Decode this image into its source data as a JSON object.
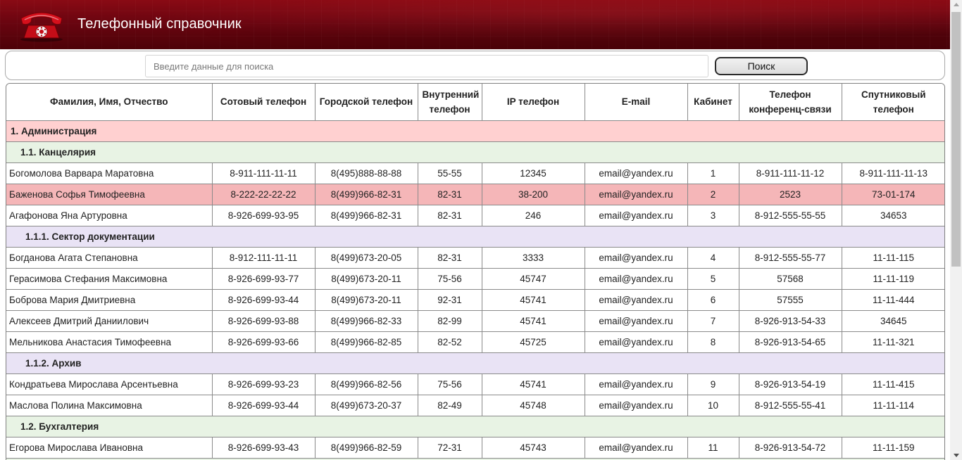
{
  "app": {
    "title": "Телефонный справочник",
    "icon": "red-telephone-icon",
    "accent": "#7a0610"
  },
  "search": {
    "placeholder": "Введите данные для поиска",
    "value": "",
    "button_label": "Поиск"
  },
  "table": {
    "columns": [
      "Фамилия, Имя, Отчество",
      "Сотовый телефон",
      "Городской телефон",
      "Внутренний телефон",
      "IP телефон",
      "E-mail",
      "Кабинет",
      "Телефон конференц-связи",
      "Спутниковый телефон"
    ],
    "rows": [
      {
        "type": "group",
        "level": 1,
        "title": "1. Администрация"
      },
      {
        "type": "group",
        "level": 2,
        "title": "1.1. Канцелярия"
      },
      {
        "type": "person",
        "cells": [
          "Богомолова Варвара Маратовна",
          "8-911-111-11-11",
          "8(495)888-88-88",
          "55-55",
          "12345",
          "email@yandex.ru",
          "1",
          "8-911-111-11-12",
          "8-911-111-11-13"
        ]
      },
      {
        "type": "person",
        "highlighted": true,
        "cells": [
          "Баженова Софья Тимофеевна",
          "8-222-22-22-22",
          "8(499)966-82-31",
          "82-31",
          "38-200",
          "email@yandex.ru",
          "2",
          "2523",
          "73-01-174"
        ]
      },
      {
        "type": "person",
        "cells": [
          "Агафонова Яна Артуровна",
          "8-926-699-93-95",
          "8(499)966-82-31",
          "82-31",
          "246",
          "email@yandex.ru",
          "3",
          "8-912-555-55-55",
          "34653"
        ]
      },
      {
        "type": "group",
        "level": 3,
        "title": "1.1.1. Сектор документации"
      },
      {
        "type": "person",
        "cells": [
          "Богданова Агата Степановна",
          "8-912-111-11-11",
          "8(499)673-20-05",
          "82-31",
          "3333",
          "email@yandex.ru",
          "4",
          "8-912-555-55-77",
          "11-11-115"
        ]
      },
      {
        "type": "person",
        "cells": [
          "Герасимова Стефания Максимовна",
          "8-926-699-93-77",
          "8(499)673-20-11",
          "75-56",
          "45747",
          "email@yandex.ru",
          "5",
          "57568",
          "11-11-119"
        ]
      },
      {
        "type": "person",
        "cells": [
          "Боброва Мария Дмитриевна",
          "8-926-699-93-44",
          "8(499)673-20-11",
          "92-31",
          "45741",
          "email@yandex.ru",
          "6",
          "57555",
          "11-11-444"
        ]
      },
      {
        "type": "person",
        "cells": [
          "Алексеев Дмитрий Даниилович",
          "8-926-699-93-88",
          "8(499)966-82-33",
          "82-99",
          "45741",
          "email@yandex.ru",
          "7",
          "8-926-913-54-33",
          "34645"
        ]
      },
      {
        "type": "person",
        "cells": [
          "Мельникова Анастасия Тимофеевна",
          "8-926-699-93-66",
          "8(499)966-82-85",
          "82-52",
          "45725",
          "email@yandex.ru",
          "8",
          "8-926-913-54-65",
          "11-11-321"
        ]
      },
      {
        "type": "group",
        "level": 3,
        "title": "1.1.2. Архив"
      },
      {
        "type": "person",
        "cells": [
          "Кондратьева Мирослава Арсентьевна",
          "8-926-699-93-23",
          "8(499)966-82-56",
          "75-56",
          "45741",
          "email@yandex.ru",
          "9",
          "8-926-913-54-19",
          "11-11-415"
        ]
      },
      {
        "type": "person",
        "cells": [
          "Маслова Полина Максимовна",
          "8-926-699-93-44",
          "8(499)673-20-37",
          "82-49",
          "45748",
          "email@yandex.ru",
          "10",
          "8-912-555-55-41",
          "11-11-114"
        ]
      },
      {
        "type": "group",
        "level": 2,
        "title": "1.2. Бухгалтерия"
      },
      {
        "type": "person",
        "cells": [
          "Егорова Мирослава Ивановна",
          "8-926-699-93-43",
          "8(499)966-82-59",
          "72-31",
          "45743",
          "email@yandex.ru",
          "11",
          "8-926-913-54-72",
          "11-11-159"
        ]
      },
      {
        "type": "group",
        "level": 2,
        "title": ""
      }
    ]
  }
}
